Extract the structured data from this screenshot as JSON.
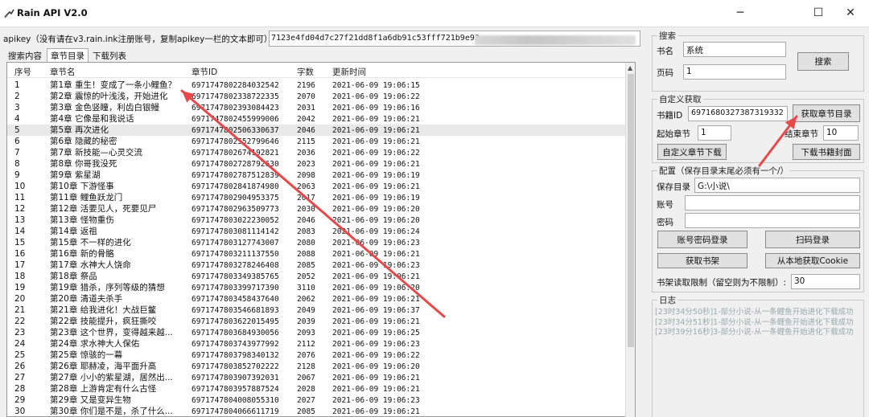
{
  "window": {
    "title": "Rain API V2.0",
    "minimize_glyph": "─",
    "maximize_glyph": "☐",
    "close_glyph": "✕"
  },
  "api": {
    "label": "apikey（没有请在v3.rain.ink注册账号，复制apikey一栏的文本即可）",
    "value": "7123e4fd04d7c27f21dd8f1a6db91c53fff721b9e93"
  },
  "tabs": [
    "搜索内容",
    "章节目录",
    "下载列表"
  ],
  "chapter_table": {
    "columns": [
      "序号",
      "章节名",
      "章节ID",
      "字数",
      "更新时间"
    ],
    "rows": [
      [
        "1",
        "第1章 重生！变成了一条小鲤鱼？",
        "6971747802284032542",
        "2196",
        "2021-06-09 19:06:15"
      ],
      [
        "2",
        "第2章 震惊的叶浅浅，开始进化",
        "6971747802338722335",
        "2070",
        "2021-06-09 19:06:22"
      ],
      [
        "3",
        "第3章 金色竖瞳，利齿白银鳗",
        "6971747802393084423",
        "2031",
        "2021-06-09 19:06:16"
      ],
      [
        "4",
        "第4章 它像是和我说话",
        "6971747802455999006",
        "2042",
        "2021-06-09 19:06:21"
      ],
      [
        "5",
        "第5章 再次进化",
        "6971747802506330637",
        "2046",
        "2021-06-09 19:06:21"
      ],
      [
        "6",
        "第6章 隐藏的秘密",
        "6971747802552799646",
        "2115",
        "2021-06-09 19:06:21"
      ],
      [
        "7",
        "第7章 新技能—心灵交流",
        "6971747802674192821",
        "2036",
        "2021-06-09 19:06:22"
      ],
      [
        "8",
        "第8章 你哥我没死",
        "6971747802728792630",
        "2023",
        "2021-06-09 19:06:21"
      ],
      [
        "9",
        "第9章 紫星湖",
        "6971747802787512839",
        "2098",
        "2021-06-09 19:06:19"
      ],
      [
        "10",
        "第10章 下游怪事",
        "6971747802841874980",
        "2063",
        "2021-06-09 19:06:21"
      ],
      [
        "11",
        "第11章 鲤鱼跃龙门",
        "6971747802904953375",
        "2017",
        "2021-06-09 19:06:19"
      ],
      [
        "12",
        "第12章 活要见人，死要见尸",
        "6971747802963509773",
        "2030",
        "2021-06-09 19:06:20"
      ],
      [
        "13",
        "第13章 怪物重伤",
        "6971747803022230052",
        "2046",
        "2021-06-09 19:06:20"
      ],
      [
        "14",
        "第14章 返祖",
        "6971747803081114142",
        "2083",
        "2021-06-09 19:06:24"
      ],
      [
        "15",
        "第15章 不一样的进化",
        "6971747803127743007",
        "2080",
        "2021-06-09 19:06:23"
      ],
      [
        "16",
        "第16章 新的骨骼",
        "6971747803211137550",
        "2088",
        "2021-06-09 19:06:21"
      ],
      [
        "17",
        "第17章 水神大人饶命",
        "6971747803278246408",
        "2085",
        "2021-06-09 19:06:23"
      ],
      [
        "18",
        "第18章 祭品",
        "6971747803349385765",
        "2052",
        "2021-06-09 19:06:21"
      ],
      [
        "19",
        "第19章 猎杀，序列等级的猜想",
        "6971747803399717390",
        "3110",
        "2021-06-09 19:06:20"
      ],
      [
        "20",
        "第20章 清道夫杀手",
        "6971747803458437640",
        "2062",
        "2021-06-09 19:06:21"
      ],
      [
        "21",
        "第21章 给我进化！大战巨鳖",
        "6971747803546681893",
        "2049",
        "2021-06-09 19:06:37"
      ],
      [
        "22",
        "第22章 技能提升，疯狂撕咬",
        "6971747803622015495",
        "2039",
        "2021-06-09 19:06:21"
      ],
      [
        "23",
        "第23章 这个世界，变得越来越...",
        "6971747803684930056",
        "2093",
        "2021-06-09 19:06:25"
      ],
      [
        "24",
        "第24章 求水神大人保佑",
        "6971747803743977992",
        "2112",
        "2021-06-09 19:06:23"
      ],
      [
        "25",
        "第25章 惊骇的一幕",
        "6971747803798340132",
        "2076",
        "2021-06-09 19:06:22"
      ],
      [
        "26",
        "第26章 耶赫凌，海平面升高",
        "6971747803852702222",
        "2128",
        "2021-06-09 19:06:20"
      ],
      [
        "27",
        "第27章 小小的紫星湖，居然出...",
        "6971747803907392031",
        "2067",
        "2021-06-09 19:06:21"
      ],
      [
        "28",
        "第28章 上游肯定有什么古怪",
        "6971747803957887524",
        "2028",
        "2021-06-09 19:06:21"
      ],
      [
        "29",
        "第29章 又是变异生物",
        "6971747804008055310",
        "2027",
        "2021-06-09 19:06:23"
      ],
      [
        "30",
        "第30章 你们是不是，杀了什么...",
        "6971747804066611719",
        "2085",
        "2021-06-09 19:06:21"
      ]
    ]
  },
  "search_panel": {
    "legend": "搜索",
    "book_label": "书名",
    "book_value": "系统",
    "page_label": "页码",
    "page_value": "1",
    "search_button": "搜索"
  },
  "custom_panel": {
    "legend": "自定义获取",
    "book_id_label": "书籍ID",
    "book_id_value": "6971680327387319332",
    "get_catalog_button": "获取章节目录",
    "start_label": "起始章节",
    "start_value": "1",
    "end_label": "结束章节",
    "end_value": "10",
    "custom_download_button": "自定义章节下载",
    "cover_download_button": "下载书籍封面"
  },
  "config_panel": {
    "legend": "配置（保存目录末尾必须有一个/）",
    "save_dir_label": "保存目录",
    "save_dir_value": "G:\\小说\\",
    "account_label": "账号",
    "account_value": "",
    "password_label": "密码",
    "password_value": "",
    "login_button": "账号密码登录",
    "scan_login_button": "扫码登录",
    "get_shelf_button": "获取书架",
    "local_cookie_button": "从本地获取Cookie",
    "limit_label": "书架读取限制（留空则为不限制）:",
    "limit_value": "30"
  },
  "log_panel": {
    "legend": "日志",
    "entries": [
      "[23时34分50秒]1-部分小说-从一条鲤鱼开始进化下载成功",
      "[23时34分51秒]1-部分小说-从一条鲤鱼开始进化下载成功",
      "[23时39分16秒]3-部分小说-从一条鲤鱼开始进化下载成功"
    ]
  },
  "colors": {
    "annotation_arrow": "#e8484a",
    "selected_row": "#e9e9e9",
    "log_text": "#9aaaaa"
  }
}
